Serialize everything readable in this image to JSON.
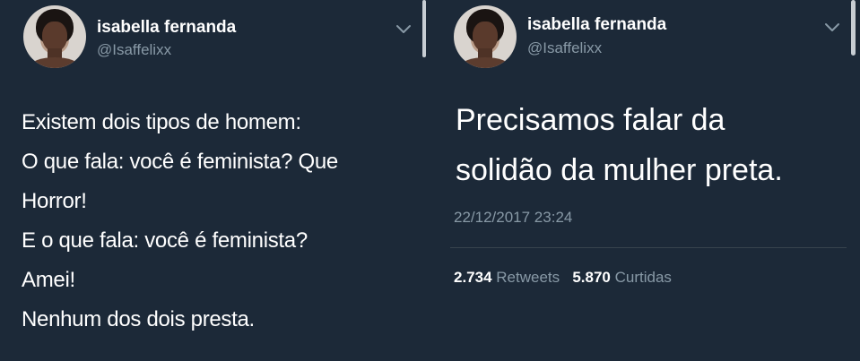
{
  "left_tweet": {
    "author": {
      "name": "isabella fernanda",
      "handle": "@Isaffelixx"
    },
    "menu_icon": "chevron-down-icon",
    "text_lines": [
      "Existem dois tipos de homem:",
      "O que fala: você é feminista? Que",
      "Horror!",
      "E o que fala: você é feminista?",
      "Amei!",
      "Nenhum dos dois presta."
    ]
  },
  "right_tweet": {
    "author": {
      "name": "isabella fernanda",
      "handle": "@Isaffelixx"
    },
    "menu_icon": "chevron-down-icon",
    "text_lines": [
      "Precisamos falar da",
      "solidão da mulher preta."
    ],
    "timestamp": "22/12/2017 23:24",
    "stats": {
      "retweets_count": "2.734",
      "retweets_label": "Retweets",
      "likes_count": "5.870",
      "likes_label": "Curtidas"
    }
  },
  "colors": {
    "background": "#1c2938",
    "text": "#ffffff",
    "secondary": "#8899a6"
  }
}
